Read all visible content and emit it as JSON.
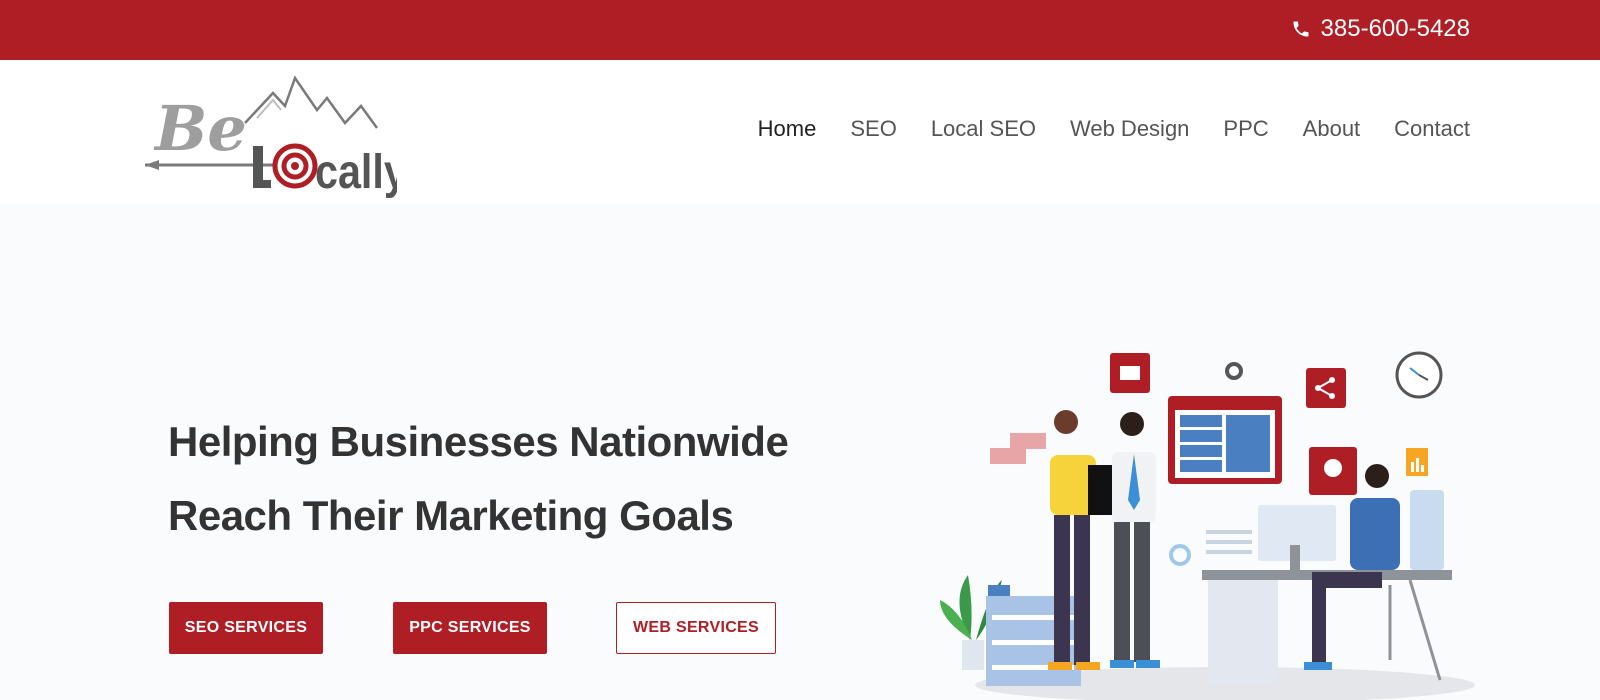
{
  "topbar": {
    "phone_icon": "phone-icon",
    "phone": "385-600-5428"
  },
  "header": {
    "logo_text": "Be Locally",
    "nav": [
      {
        "label": "Home"
      },
      {
        "label": "SEO"
      },
      {
        "label": "Local SEO"
      },
      {
        "label": "Web Design"
      },
      {
        "label": "PPC"
      },
      {
        "label": "About"
      },
      {
        "label": "Contact"
      }
    ]
  },
  "hero": {
    "title_line1": "Helping Businesses Nationwide",
    "title_line2": "Reach Their Marketing Goals",
    "buttons": {
      "seo": "SEO SERVICES",
      "ppc": "PPC SERVICES",
      "web": "WEB SERVICES"
    }
  },
  "colors": {
    "brand_red": "#b01e25",
    "text_dark": "#333333",
    "page_bg": "#fafbfd"
  }
}
